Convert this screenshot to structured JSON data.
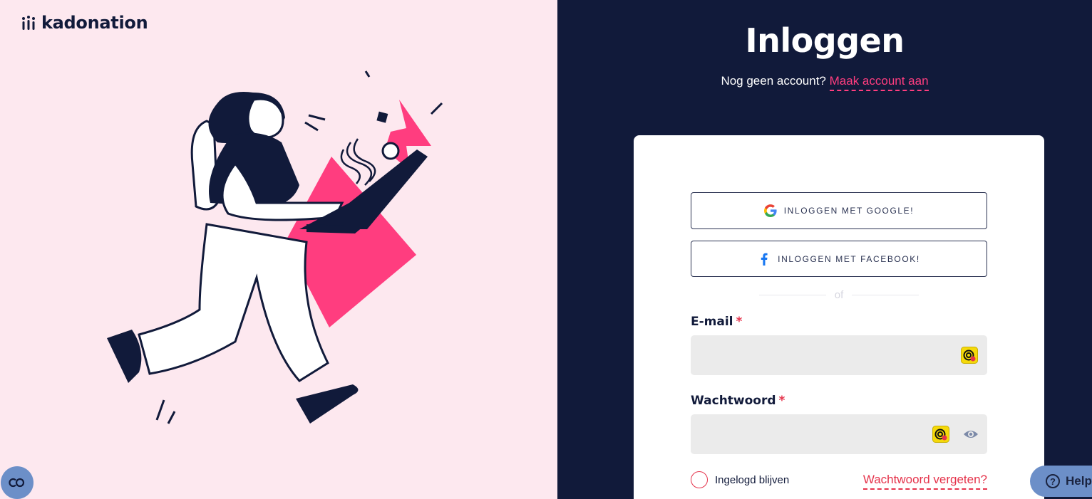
{
  "brand": {
    "name": "kadonation"
  },
  "login": {
    "title": "Inloggen",
    "no_account_text": "Nog geen account?",
    "create_account_link": "Maak account aan",
    "google_button": "INLOGGEN MET GOOGLE!",
    "facebook_button": "INLOGGEN MET FACEBOOK!",
    "divider_text": "of",
    "email_label": "E-mail",
    "password_label": "Wachtwoord",
    "required_marker": "*",
    "email_value": "",
    "password_value": "",
    "remember_label": "Ingelogd blijven",
    "forgot_link": "Wachtwoord vergeten?"
  },
  "widgets": {
    "help_label": "Help"
  },
  "colors": {
    "navy": "#111a3a",
    "pink_bg": "#fde8ef",
    "accent_pink": "#ff3d7f",
    "required_red": "#e5334b",
    "widget_blue": "#6c8fc8"
  },
  "icons": [
    "google-icon",
    "facebook-icon",
    "password-manager-icon",
    "eye-icon",
    "cookie-consent-icon",
    "help-icon"
  ]
}
